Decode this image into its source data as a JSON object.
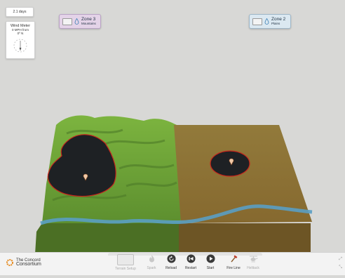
{
  "status": {
    "days": "2.1 days"
  },
  "wind_meter": {
    "title": "Wind Meter",
    "speed": "0 MPH from",
    "direction": "0º N"
  },
  "zones": [
    {
      "name": "Zone 3",
      "terrain": "Mountains",
      "color": "#e4d3e8"
    },
    {
      "name": "Zone 2",
      "terrain": "Plains",
      "color": "#dbe8f1"
    }
  ],
  "toolbar": {
    "logo_line1": "The Concord",
    "logo_line2": "Consortium",
    "buttons": [
      {
        "label": "Terrain Setup",
        "icon": "terrain-setup-icon",
        "enabled": false
      },
      {
        "label": "Spark",
        "icon": "flame-icon",
        "enabled": false
      },
      {
        "label": "Reload",
        "icon": "reload-icon",
        "enabled": true
      },
      {
        "label": "Restart",
        "icon": "restart-icon",
        "enabled": true
      },
      {
        "label": "Start",
        "icon": "play-icon",
        "enabled": true
      },
      {
        "label": "Fire Line",
        "icon": "axe-icon",
        "enabled": true
      },
      {
        "label": "Helitack",
        "icon": "helicopter-icon",
        "enabled": false
      }
    ]
  },
  "colors": {
    "mountains": "#6aa23a",
    "plains": "#8e7438",
    "burned": "#1e2124",
    "fire": "#c7261d",
    "river": "#5a9fc4"
  }
}
